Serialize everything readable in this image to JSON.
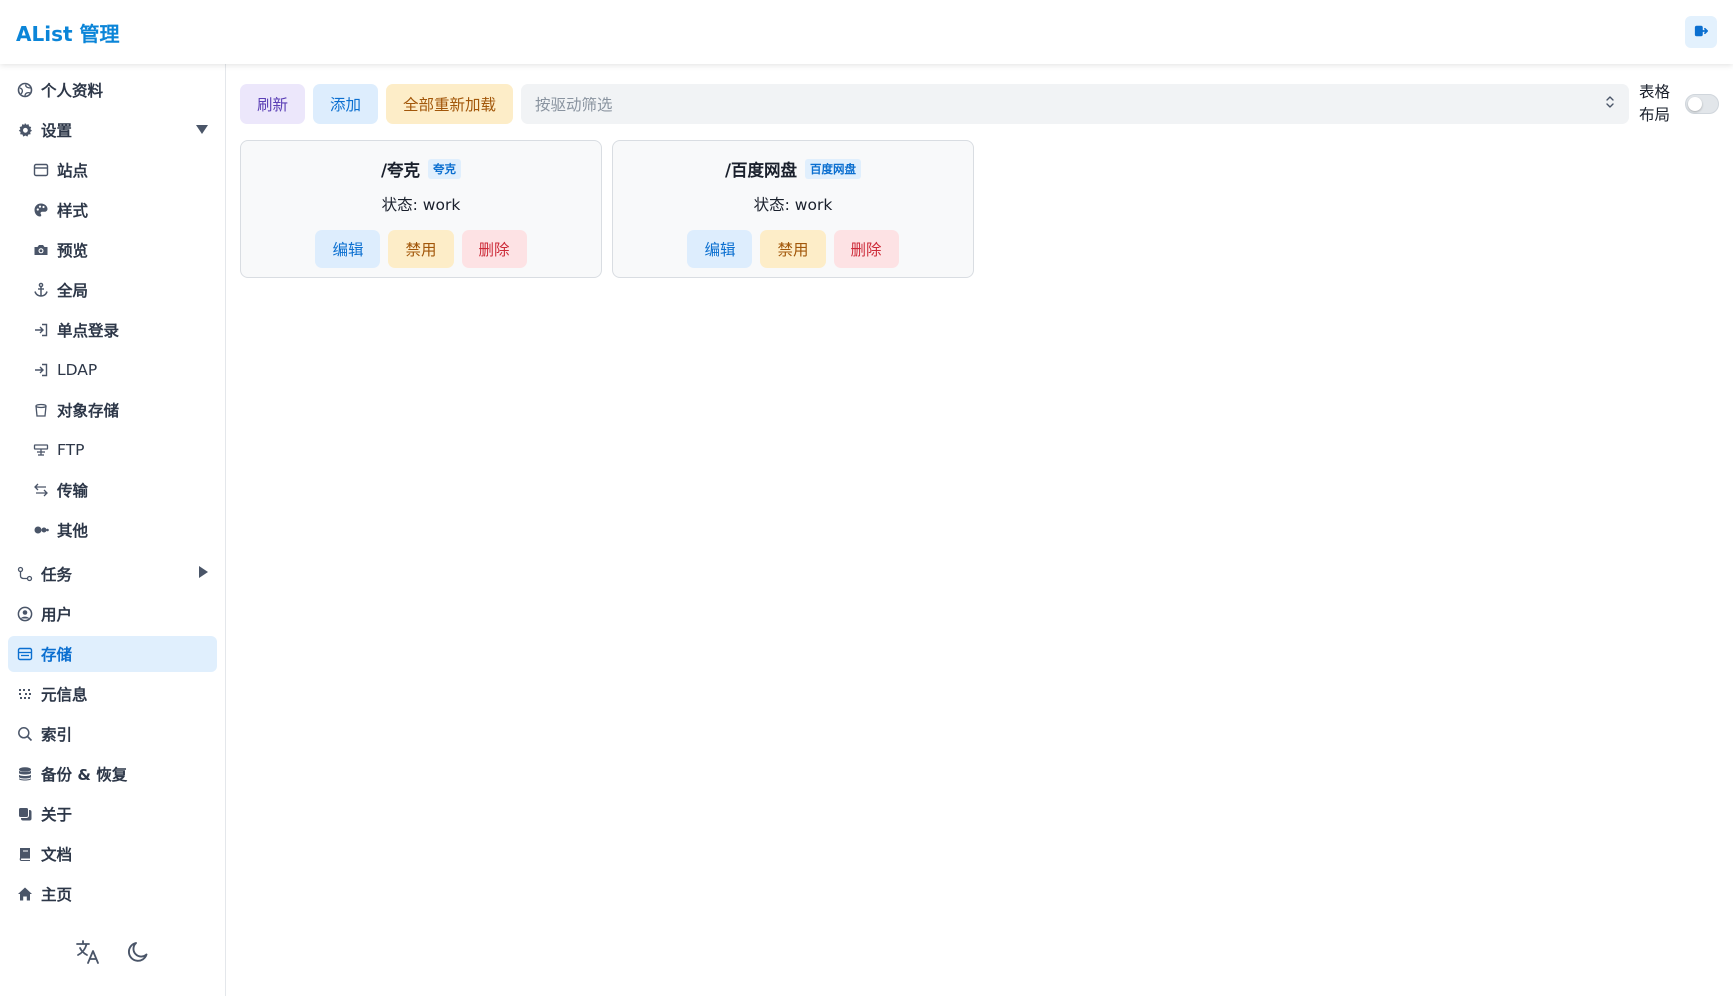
{
  "app": {
    "title": "AList 管理"
  },
  "sidebar": {
    "items": [
      {
        "label": "个人资料",
        "icon": "profile-icon"
      },
      {
        "label": "设置",
        "icon": "gear-icon",
        "expanded": true
      },
      {
        "label": "站点",
        "icon": "window-icon"
      },
      {
        "label": "样式",
        "icon": "palette-icon"
      },
      {
        "label": "预览",
        "icon": "camera-icon"
      },
      {
        "label": "全局",
        "icon": "anchor-icon"
      },
      {
        "label": "单点登录",
        "icon": "login-icon"
      },
      {
        "label": "LDAP",
        "icon": "login-icon"
      },
      {
        "label": "对象存储",
        "icon": "bucket-icon"
      },
      {
        "label": "FTP",
        "icon": "ftp-icon"
      },
      {
        "label": "传输",
        "icon": "transfer-icon"
      },
      {
        "label": "其他",
        "icon": "other-icon"
      },
      {
        "label": "任务",
        "icon": "task-icon",
        "expanded": false
      },
      {
        "label": "用户",
        "icon": "user-icon"
      },
      {
        "label": "存储",
        "icon": "storage-icon",
        "active": true
      },
      {
        "label": "元信息",
        "icon": "meta-icon"
      },
      {
        "label": "索引",
        "icon": "search-icon"
      },
      {
        "label": "备份 & 恢复",
        "icon": "database-icon"
      },
      {
        "label": "关于",
        "icon": "about-icon"
      },
      {
        "label": "文档",
        "icon": "book-icon"
      },
      {
        "label": "主页",
        "icon": "home-icon"
      }
    ]
  },
  "toolbar": {
    "refresh_label": "刷新",
    "add_label": "添加",
    "reload_all_label": "全部重新加载",
    "filter_placeholder": "按驱动筛选",
    "table_layout_label_1": "表格",
    "table_layout_label_2": "布局",
    "table_layout_enabled": false
  },
  "storages": [
    {
      "mount_path": "/夸克",
      "driver": "夸克",
      "status": "状态: work",
      "edit_label": "编辑",
      "disable_label": "禁用",
      "delete_label": "删除"
    },
    {
      "mount_path": "/百度网盘",
      "driver": "百度网盘",
      "status": "状态: work",
      "edit_label": "编辑",
      "disable_label": "禁用",
      "delete_label": "删除"
    }
  ],
  "colors": {
    "brand": "#0b85d8",
    "active_bg": "#e0effd",
    "purple_btn_bg": "#ece7fb",
    "blue_btn_bg": "#ddedfd",
    "yellow_btn_bg": "#fdedc8",
    "red_btn_bg": "#fde2e4"
  }
}
